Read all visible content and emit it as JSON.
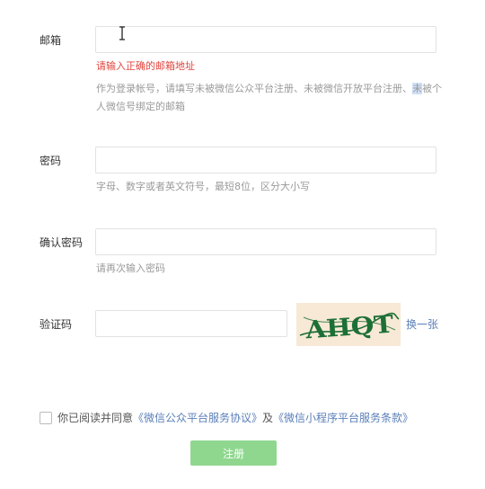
{
  "email": {
    "label": "邮箱",
    "value": "",
    "error": "请输入正确的邮箱地址",
    "hint_before": "作为登录帐号，请填写未被微信公众平台注册、未被微信开放平台注",
    "hint_mid": "册、",
    "hint_highlighted": "未",
    "hint_after": "被个人微信号绑定的邮箱"
  },
  "password": {
    "label": "密码",
    "value": "",
    "hint": "字母、数字或者英文符号，最短8位，区分大小写"
  },
  "confirm_password": {
    "label": "确认密码",
    "value": "",
    "hint": "请再次输入密码"
  },
  "captcha": {
    "label": "验证码",
    "value": "",
    "image_text": "AHQT",
    "refresh_label": "换一张"
  },
  "agreement": {
    "checked": false,
    "prefix": "你已阅读并同意",
    "service_agreement": "《微信公众平台服务协议》",
    "conjunction": "及",
    "mini_program_terms": "《微信小程序平台服务条款》"
  },
  "submit": {
    "label": "注册"
  },
  "colors": {
    "error": "#e0453e",
    "link": "#5a7fb8",
    "hint": "#9a9a9a",
    "button": "#8fd78f",
    "captcha_ink": "#1d6f36",
    "captcha_bg": "#f7e9d6"
  },
  "icons": {
    "cursor": "text-cursor-icon",
    "checkbox": "checkbox-icon"
  }
}
